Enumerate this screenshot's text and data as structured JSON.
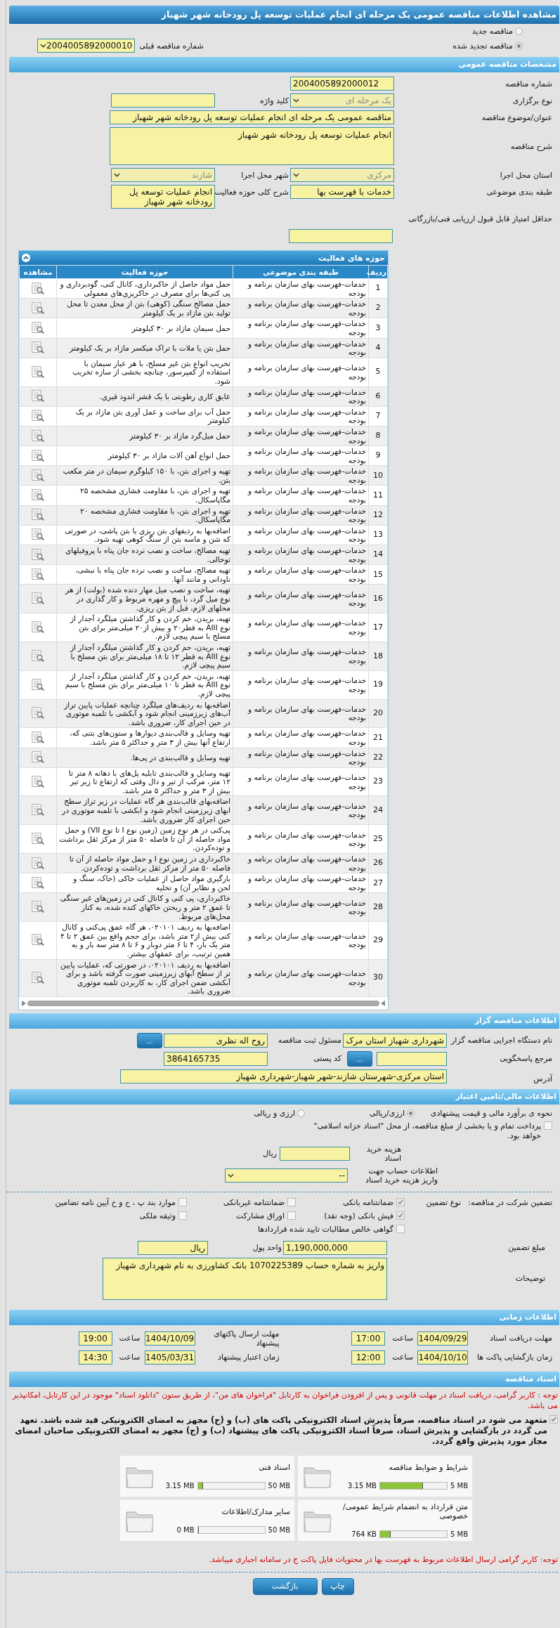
{
  "page_title": "مشاهده اطلاعات مناقصه عمومی یک مرحله ای انجام عملیات توسعه پل رودخانه شهر شهباز",
  "tender_type": [
    {
      "label": "مناقصه جدید",
      "selected": false
    },
    {
      "label": "مناقصه تجدید شده",
      "selected": true
    }
  ],
  "previous_tender": {
    "label": "شماره مناقصه قبلی",
    "value": "2004005892000010"
  },
  "general": {
    "title": "مشخصات مناقصه عمومی",
    "tender_number": {
      "label": "شماره مناقصه",
      "value": "2004005892000012"
    },
    "holding_type": {
      "label": "نوع برگزاری",
      "value": "یک مرحله ای",
      "disabled": true
    },
    "keyword": {
      "label": "کلید واژه"
    },
    "subject": {
      "label": "عنوان/موضوع مناقصه",
      "value": "مناقصه عمومی یک مرحله ای انجام عملیات توسعه پل رودخانه شهر شهباز"
    },
    "description": {
      "label": "شرح مناقصه",
      "value": "انجام عملیات توسعه پل رودخانه شهر شهباز"
    },
    "province": {
      "label": "استان محل اجرا",
      "value": "مرکزی",
      "disabled": true
    },
    "city": {
      "label": "شهر محل اجرا",
      "value": "شازند",
      "disabled": true
    },
    "category": {
      "label": "طبقه بندی موضوعی",
      "value": "خدمات با فهرست بها"
    },
    "activity_scope": {
      "label": "شرح کلی حوزه فعالیت",
      "value": "انجام عملیات توسعه پل رودخانه شهر شهباز"
    },
    "min_score": {
      "label": "حداقل امتیاز قابل قبول ارزیابی فنی/بازرگانی"
    }
  },
  "activities": {
    "title": "حوزه های فعالیت",
    "columns": [
      "ردیف",
      "طبقه بندی موضوعی",
      "حوزه فعالیت",
      "مشاهده"
    ],
    "rows": [
      {
        "index": "1",
        "category": "خدمات-فهرست بهای سازمان برنامه و بودجه",
        "scope": "حمل مواد حاصل از خاکبرداری، کانال کنی، گودبرداری و پی کنی‌ها برای مصرف در خاکریزی‌های معمولی"
      },
      {
        "index": "2",
        "category": "خدمات-فهرست بهای سازمان برنامه و بودجه",
        "scope": "حمل مصالح سنگی (کوهی) بتن از محل معدن تا محل تولید بتن مازاد بر یک کیلومتر"
      },
      {
        "index": "3",
        "category": "خدمات-فهرست بهای سازمان برنامه و بودجه",
        "scope": "حمل سیمان مازاد بر ۳۰ کیلومتر"
      },
      {
        "index": "4",
        "category": "خدمات-فهرست بهای سازمان برنامه و بودجه",
        "scope": "حمل بتن یا ملات با تراک میکسر مازاد بر یک کیلومتر"
      },
      {
        "index": "5",
        "category": "خدمات-فهرست بهای سازمان برنامه و بودجه",
        "scope": "تخریب انواع بتن غیر مسلح، با هر عیار سیمان با استفاده از کمپرسور، چنانچه بخشی از سازه تخریب شود."
      },
      {
        "index": "6",
        "category": "خدمات-فهرست بهای سازمان برنامه و بودجه",
        "scope": "عایق کاری رطوبتی با یک قشر اندود قیری."
      },
      {
        "index": "7",
        "category": "خدمات-فهرست بهای سازمان برنامه و بودجه",
        "scope": "حمل آب برای ساخت و عمل آوری بتن مازاد بر یک کیلومتر"
      },
      {
        "index": "8",
        "category": "خدمات-فهرست بهای سازمان برنامه و بودجه",
        "scope": "حمل میل‌گرد مازاد بر ۳۰ کیلومتر"
      },
      {
        "index": "9",
        "category": "خدمات-فهرست بهای سازمان برنامه و بودجه",
        "scope": "حمل انواع آهن آلات مازاد بر ۳۰ کیلومتر"
      },
      {
        "index": "10",
        "category": "خدمات-فهرست بهای سازمان برنامه و بودجه",
        "scope": "تهیه و اجرای بتن، با ۱۵۰ کیلوگرم سیمان در متر مکعب بتن."
      },
      {
        "index": "11",
        "category": "خدمات-فهرست بهای سازمان برنامه و بودجه",
        "scope": "تهیه و اجرای بتن، با مقاومت فشاری مشخصه ۲۵ مگاپاسکال."
      },
      {
        "index": "12",
        "category": "خدمات-فهرست بهای سازمان برنامه و بودجه",
        "scope": "تهیه و اجرای بتن، با مقاومت فشاری مشخصه ۲۰ مگاپاسکال."
      },
      {
        "index": "13",
        "category": "خدمات-فهرست بهای سازمان برنامه و بودجه",
        "scope": "اضافه‌بها به ردیفهای بتن ریزی یا بتن پاشی، در صورتی که شن و ماسه بتن از سنگ کوهی تهیه شود."
      },
      {
        "index": "14",
        "category": "خدمات-فهرست بهای سازمان برنامه و بودجه",
        "scope": "تهیه مصالح، ساخت و نصب نرده جان پناه با پروفیلهای توخالی."
      },
      {
        "index": "15",
        "category": "خدمات-فهرست بهای سازمان برنامه و بودجه",
        "scope": "تهیه مصالح، ساخت و نصب نرده جان پناه با نبشی، ناودانی و مانند آنها."
      },
      {
        "index": "16",
        "category": "خدمات-فهرست بهای سازمان برنامه و بودجه",
        "scope": "تهیه، ساخت و نصب میل مهار دنده شده (بولت) از هر نوع میل گرد، با پیچ و مهره مربوط و کار گذاری در محلهای لازم، قبل از بتن ریزی."
      },
      {
        "index": "17",
        "category": "خدمات-فهرست بهای سازمان برنامه و بودجه",
        "scope": "تهیه، بریدن، خم کردن و کار گذاشتن میلگرد آجدار از نوع AIII به قطر۲۰ و بیش از۲۰ میلی‌متر برای بتن مسلح با سیم پیچی لازم."
      },
      {
        "index": "18",
        "category": "خدمات-فهرست بهای سازمان برنامه و بودجه",
        "scope": "تهیه، بریدن، خم کردن و کار گذاشتن میلگرد آجدار از نوع AIII به قطر ۱۲ تا ۱۸ میلی‌متر برای بتن مسلح با سیم پیچی لازم."
      },
      {
        "index": "19",
        "category": "خدمات-فهرست بهای سازمان برنامه و بودجه",
        "scope": "تهیه، بریدن، خم کردن و کار گذاشتن میلگرد آجدار از نوع AIII به قطر تا ۱۰ میلی‌متر برای بتن مسلح با سیم پیچی لازم."
      },
      {
        "index": "20",
        "category": "خدمات-فهرست بهای سازمان برنامه و بودجه",
        "scope": "اضافه‌بها به ردیف‌های میلگرد چنانچه عملیات پایین تراز آب‌های زیرزمینی انجام شود و آبکشی با تلمبه موتوری در حین اجرای کار، ضروری باشد."
      },
      {
        "index": "21",
        "category": "خدمات-فهرست بهای سازمان برنامه و بودجه",
        "scope": "تهیه وسایل و قالب‌بندی دیوارها و ستون‌های بتنی که، ارتفاع آنها بیش از ۳ متر و حداکثر ۵ متر باشد."
      },
      {
        "index": "22",
        "category": "خدمات-فهرست بهای سازمان برنامه و بودجه",
        "scope": "تهیه وسایل و قالب‌بندی در پی‌ها."
      },
      {
        "index": "23",
        "category": "خدمات-فهرست بهای سازمان برنامه و بودجه",
        "scope": "تهیه وسایل و قالب‌بندی تابلیه پل‌های با دهانه ۸ متر تا ۱۲ متر، مرکب از تیر و دال وقتی که ارتفاع تا زیر تیر بیش از ۳ متر و حداکثر ۵ متر باشد."
      },
      {
        "index": "24",
        "category": "خدمات-فهرست بهای سازمان برنامه و بودجه",
        "scope": "اضافه‌بهای قالب‌بندی هر گاه عملیات در زیر تراز سطح ابهای زیرزمینی انجام شود و ابکشی با تلمبه موتوری در حین اجرای کار ضروری باشد."
      },
      {
        "index": "25",
        "category": "خدمات-فهرست بهای سازمان برنامه و بودجه",
        "scope": "پی‌کنی در هر نوع زمین (زمین نوع I تا نوع VII) و حمل مواد حاصله از آن تا فاصله ۵۰ متر از مرکز ثقل برداشت و توده‌کردن."
      },
      {
        "index": "26",
        "category": "خدمات-فهرست بهای سازمان برنامه و بودجه",
        "scope": "خاکبرداری در زمین نوع I و حمل مواد حاصله از آن تا فاصله ۵۰ متر از مرکز ثقل برداشت و توده‌کردن."
      },
      {
        "index": "27",
        "category": "خدمات-فهرست بهای سازمان برنامه و بودجه",
        "scope": "بارگیری مواد حاصل از عملیات خاکی (خاک، سنگ و لجن و نظایر آن) و تخلیه"
      },
      {
        "index": "28",
        "category": "خدمات-فهرست بهای سازمان برنامه و بودجه",
        "scope": "خاکبرداری، پی کنی و کانال کنی در زمین‌های غیر سنگی تا عمق ۲ متر و ریختن خاکهای کنده شده، به کنار محل‌های مربوط."
      },
      {
        "index": "29",
        "category": "خدمات-فهرست بهای سازمان برنامه و بودجه",
        "scope": "اضافه‌بها به ردیف ۰۲۰۱۰۱، هر گاه عمق پی‌کنی و کانال کنی بیش از۲ متر باشد، برای حجم واقع بین عمق ۲ تا ۴ متر یک بار، ۴ تا ۶ متر دوبار و ۶ تا ۸ متر سه بار و به همین ترتیب، برای عمقهای بیشتر."
      },
      {
        "index": "30",
        "category": "خدمات-فهرست بهای سازمان برنامه و بودجه",
        "scope": "اضافه‌بها به ردیف ۰۲۰۱۰۱، در صورتی که، عملیات پایین تر از سطح آبهای زیرزمینی صورت گرفته باشد و برای آبکشی ضمن اجرای کار، به کاربردن تلمبه موتوری ضروری باشد."
      }
    ]
  },
  "organizer": {
    "title": "اطلاعات مناقصه گزار",
    "agency": {
      "label": "نام دستگاه اجرایی مناقصه گزار",
      "value": "شهرداری شهباز استان مرک"
    },
    "registrar": {
      "label": "مسئول ثبت مناقصه",
      "value": "روح اله نظری",
      "button": "..."
    },
    "response_ref": {
      "label": "مرجع پاسخگویی",
      "button": "..."
    },
    "postal_code": {
      "label": "کد پستی",
      "value": "3864165735"
    },
    "address": {
      "label": "آدرس",
      "value": "استان مرکزی-شهرستان شازند-شهر شهباز-شهرداری شهباز"
    }
  },
  "finance": {
    "title": "اطلاعات مالی/تامین اعتبار",
    "estimate": {
      "label": "نحوه ی برآورد مالی و قیمت پیشنهادی",
      "options": [
        {
          "label": "ارزی/ریالی",
          "selected": true
        },
        {
          "label": "ارزی و ریالی",
          "selected": false
        }
      ]
    },
    "treasury": {
      "label": "پرداخت تمام و یا بخشی از مبلغ مناقصه، از محل \"اسناد خزانه اسلامی\" خواهد بود.",
      "checked": false
    },
    "doc_fee": {
      "label": "هزینه خرید اسناد",
      "unit": "ریال"
    },
    "account": {
      "label": "اطلاعات حساب جهت واریز هزینه خرید اسناد",
      "value": "--"
    },
    "guarantee": {
      "label": "تضمین شرکت در مناقصه:",
      "type_label": "نوع تضمین",
      "options": [
        {
          "label": "ضمانتنامه بانکی",
          "checked": true
        },
        {
          "label": "ضمانتنامه غیربانکی",
          "checked": false
        },
        {
          "label": "موارد بند پ ، ح و خ آیین نامه تضامین",
          "checked": false
        },
        {
          "label": "فیش بانکی (وجه نقد)",
          "checked": true
        },
        {
          "label": "اوراق مشارکت",
          "checked": false
        },
        {
          "label": "وثیقه ملکی",
          "checked": false
        },
        {
          "label": "گواهی خالص مطالبات تایید شده قراردادها",
          "checked": false
        }
      ]
    },
    "amount": {
      "label": "مبلغ تضمین",
      "value": "1,190,000,000"
    },
    "currency": {
      "label": "واحد پول",
      "value": "ریال"
    },
    "notes": {
      "label": "توضیحات",
      "value": "واریز به شماره حساب 1070225389 بانک کشاورزی به نام شهرداری شهباز"
    }
  },
  "timing": {
    "title": "اطلاعات زمانی",
    "items": [
      {
        "label": "مهلت دریافت اسناد",
        "date": "1404/09/29",
        "time_label": "ساعت",
        "time": "17:00"
      },
      {
        "label": "مهلت ارسال پاکتهای پیشنهاد",
        "date": "1404/10/09",
        "time_label": "ساعت",
        "time": "19:00"
      },
      {
        "label": "زمان بازگشایی پاکت ها",
        "date": "1404/10/10",
        "time_label": "ساعت",
        "time": "12:00"
      },
      {
        "label": "زمان اعتبار پیشنهاد",
        "date": "1405/03/31",
        "time_label": "ساعت",
        "time": "14:30"
      }
    ]
  },
  "documents": {
    "title": "اسناد مناقصه",
    "notice": "توجه : کاربر گرامی، دریافت اسناد در مهلت قانونی و پس از افزودن فراخوان به کارتابل \"فراخوان های من\"، از طریق ستون \"دانلود اسناد\" موجود در این کارتابل، امکانپذیر می باشد.",
    "commitment": {
      "text": "متعهد می شود در اسناد مناقصه، صرفاً پذیرش اسناد الکترونیکی پاکت های (ب) و (ج) مجهز به امضای الکترونیکی قید شده باشد. تعهد می گردد در بازگشایی و پذیرش اسناد، صرفاً اسناد الکترونیکی پاکت های پیشنهاد (ب) و (ج) مجهز به امضای الکترونیکی صاحبان امضای مجاز مورد پذیرش واقع گردد.",
      "checked": true
    },
    "files": [
      {
        "name": "شرایط و ضوابط مناقصه",
        "size": "3.15 MB",
        "limit": "5 MB",
        "level": 0.63
      },
      {
        "name": "اسناد فنی",
        "size": "3.15 MB",
        "limit": "50 MB",
        "level": 0.063
      },
      {
        "name": "متن قرارداد به انضمام شرایط عمومی/خصوصی",
        "size": "764 KB",
        "limit": "5 MB",
        "level": 0.15
      },
      {
        "name": "سایر مدارک/اطلاعات",
        "size": "0 MB",
        "limit": "50 MB",
        "level": 0
      }
    ],
    "footer_notice": "توجه: کاربر گرامی ارسال اطلاعات مربوط به فهرست بها در محتویات فایل پاکت ج در سامانه اجباری میباشد."
  },
  "buttons": [
    "چاپ",
    "بازگشت"
  ]
}
